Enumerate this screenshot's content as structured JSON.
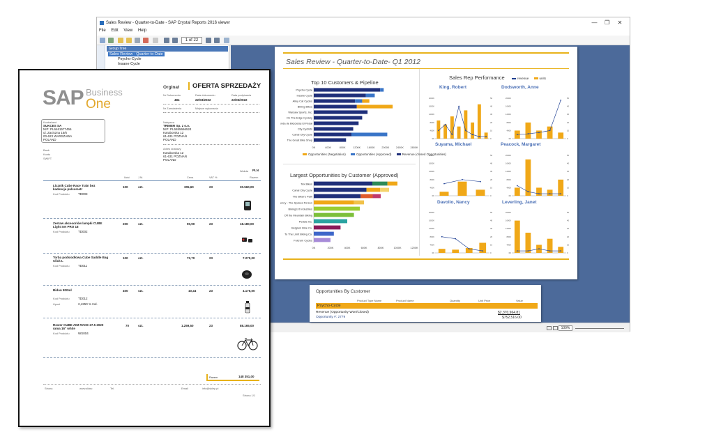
{
  "viewer": {
    "window_title": "Sales Review - Quarter-to-Date - SAP Crystal Reports 2016 viewer",
    "window_buttons": [
      "—",
      "❐",
      "✕"
    ],
    "menu": [
      "File",
      "Edit",
      "View",
      "Help"
    ],
    "page_indicator": "1 of 22",
    "group_tree": {
      "header": "Group Tree",
      "root": "Sales Review - Quarter-to-Date",
      "children": [
        "Psycho-Cycle",
        "Insane Cycle"
      ]
    },
    "zoom": "100%"
  },
  "report": {
    "title": "Sales Review - Quarter-to-Date- Q1 2012",
    "colors": {
      "gold": "#f0a818",
      "navy": "#1f2f7a",
      "blue": "#3874c7",
      "accent_line": "#e8b21a"
    },
    "top10": {
      "title": "Top 10 Customers & Pipeline",
      "legend": [
        "Opportunities (Negotiation)",
        "Opportunities (Approved)",
        "Revenue (closed Opportunities)"
      ]
    },
    "largest": {
      "title": "Largest Opportunities by Customer (Approved)"
    },
    "rep_performance": {
      "title": "Sales Rep Performance",
      "legend": [
        "revenue",
        "units"
      ],
      "reps": [
        "King, Robert",
        "Dodsworth, Anne",
        "Suyama, Michael",
        "Peacock, Margaret",
        "Davolio, Nancy",
        "Leverling, Janet"
      ]
    }
  },
  "chart_data": [
    {
      "type": "bar",
      "title": "Top 10 Customers & Pipeline",
      "orientation": "horizontal",
      "categories": [
        "Psycho Cycle",
        "Insane Cycle",
        "Alley Cat Cycles",
        "Biking Bikes",
        "Warsaw Sports, Inc.",
        "On The Edge Cyclery",
        "Tienda de Bicicletas El Pedal",
        "City Cyclists",
        "Canal City Cycle",
        "The Great Bike Shop"
      ],
      "series": [
        {
          "name": "Revenue (closed Opportunities)",
          "values": [
            1850000,
            1450000,
            1150000,
            1200000,
            1500000,
            1350000,
            1250000,
            1100000,
            1050000,
            900000
          ]
        },
        {
          "name": "Opportunities (Approved)",
          "values": [
            100000,
            250000,
            200000,
            0,
            0,
            0,
            0,
            0,
            1000000,
            0
          ]
        },
        {
          "name": "Opportunities (Negotiation)",
          "values": [
            0,
            0,
            200000,
            1000000,
            0,
            0,
            0,
            0,
            0,
            0
          ]
        }
      ],
      "x_ticks": [
        "0K",
        "400K",
        "800K",
        "1200K",
        "1600K",
        "2000K",
        "2400K",
        "2800K"
      ],
      "xlim": [
        0,
        2800000
      ]
    },
    {
      "type": "bar",
      "title": "Largest Opportunities by Customer (Approved)",
      "orientation": "horizontal",
      "categories": [
        "Tek Bikes",
        "Canal City Cycle",
        "The Biker's Path",
        "Benny - The Spokes Person",
        "Biking's It Industries",
        "Off the Mountain Biking",
        "Pedals Inc.",
        "Belgium Bike Co.",
        "To The Limit Biking Co.",
        "Fulcrum Cycles"
      ],
      "values": [
        1000000,
        900000,
        800000,
        600000,
        550000,
        480000,
        400000,
        320000,
        240000,
        200000
      ],
      "x_ticks": [
        "0K",
        "200K",
        "400K",
        "600K",
        "800K",
        "1000K",
        "1200K"
      ],
      "xlim": [
        0,
        1200000
      ]
    }
  ],
  "opportunities": {
    "title": "Opportunities By Customer",
    "columns": [
      "Product Type Name",
      "Product Name",
      "Quantity",
      "Unit Price",
      "Value"
    ],
    "group": "Psycho-Cycle",
    "row1_label": "Revenue (Opportunity Won/Closed)",
    "row1_value": "$2,370,964.81",
    "row2_label": "Opportunity #: 2779",
    "row2_value": "$752,516.00"
  },
  "quote": {
    "logo_sap": "SAP",
    "logo_business": "Business",
    "logo_one": "One",
    "original": "Orginał",
    "doc_title": "OFERTA SPRZEDAŻY",
    "meta_labels": [
      "Nr Dokumentu",
      "Data dokumentu",
      "Data podpisania"
    ],
    "meta_values": [
      "484",
      "22/03/2022",
      "22/03/2022"
    ],
    "ordering_label": "Nr Zamówienia",
    "delivery_label": "Miejsce wykonania",
    "contractor_label": "Kontrahent",
    "contractor": [
      "SUKCES SA",
      "NIP: PL6461577456",
      "ul. Zaciszna 15/6",
      "00-623 WARSZAWA",
      "POLAND"
    ],
    "seller_label": "Nabywca",
    "seller": [
      "TRIMER Sp. z o.o.",
      "NIP: PL5555666524",
      "Karaborska 12",
      "61-631 POZNAŃ",
      "POLAND"
    ],
    "receiver_label": "Adres dostawy",
    "receiver": [
      "Karaborska 12",
      "61-631 POZNAŃ",
      "POLAND"
    ],
    "left_labels": [
      "Bank",
      "Konto",
      "SWIFT"
    ],
    "currency_label": "Waluta",
    "currency": "PLN",
    "headers": [
      "Ilość",
      "J.M.",
      "Cena",
      "VAT %",
      "Razem"
    ],
    "items": [
      {
        "name": "Licznik Cube Race Train bez kadencja pulsometr",
        "code_label": "Kod Produktu",
        "code": "TD003",
        "qty": "100",
        "unit": "szt.",
        "price": "305,60",
        "vat": "23",
        "total": "30.560,00"
      },
      {
        "name": "Zestaw akcesoriów lampki CUBE Light Set PRO 18",
        "code_label": "Kod Produktu",
        "code": "TD002",
        "qty": "200",
        "unit": "szt.",
        "price": "90,90",
        "vat": "23",
        "total": "18.180,00"
      },
      {
        "name": "Torba podsiodłowa Cube Saddle Bag Click L",
        "code_label": "Kod Produktu",
        "code": "TD011",
        "qty": "100",
        "unit": "szt.",
        "price": "72,70",
        "vat": "23",
        "total": "7.270,00"
      },
      {
        "name": "Bidon 800ml",
        "code_label": "Kod Produktu",
        "code": "TD012",
        "qty": "400",
        "unit": "szt.",
        "price": "10,44",
        "vat": "23",
        "total": "4.176,00",
        "extra_label": "Upust",
        "extra": "2,4250 % Ind."
      },
      {
        "name": "Rower CUBE AIM RACE 27.5 2020 rama 16\" white",
        "code_label": "Kod Produktu",
        "code": "WS004",
        "qty": "70",
        "unit": "szt.",
        "price": "1.259,50",
        "vat": "23",
        "total": "88.165,00"
      }
    ],
    "total_label": "Razem",
    "total": "148 351,00",
    "footer": [
      "Strona",
      "www.sklep",
      "Tel.",
      "Email",
      "info@sklep.pl"
    ],
    "page": "Strona 1/1"
  }
}
